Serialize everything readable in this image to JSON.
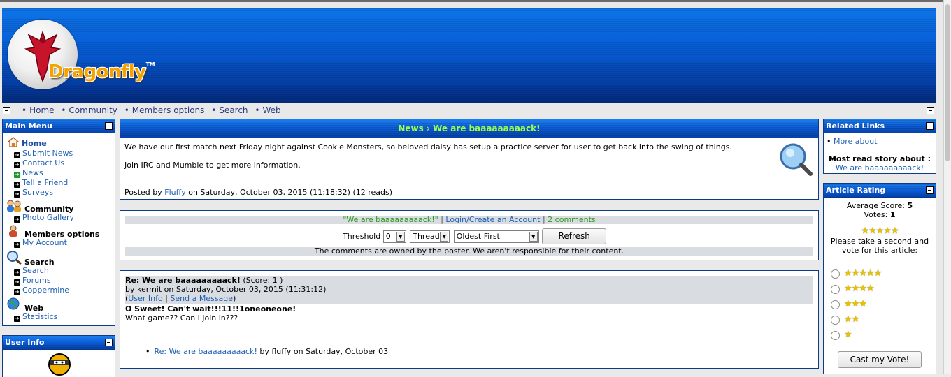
{
  "header": {
    "logo_text": "Dragonfly",
    "trademark": "TM"
  },
  "navbar": {
    "items": [
      {
        "label": "Home"
      },
      {
        "label": "Community"
      },
      {
        "label": "Members options"
      },
      {
        "label": "Search"
      },
      {
        "label": "Web"
      }
    ]
  },
  "main_menu": {
    "title": "Main Menu",
    "home": {
      "label": "Home",
      "links": [
        "Submit News",
        "Contact Us",
        "News",
        "Tell a Friend",
        "Surveys"
      ]
    },
    "community": {
      "label": "Community",
      "links": [
        "Photo Gallery"
      ]
    },
    "members": {
      "label": "Members options",
      "links": [
        "My Account"
      ]
    },
    "search": {
      "label": "Search",
      "links": [
        "Search",
        "Forums",
        "Coppermine"
      ]
    },
    "web": {
      "label": "Web",
      "links": [
        "Statistics"
      ]
    }
  },
  "user_info": {
    "title": "User Info"
  },
  "article": {
    "breadcrumb": "News › We are baaaaaaaaack!",
    "body_1": "We have our first match next Friday night against Cookie Monsters, so beloved daisy has setup a practice server for user to get back into the swing of things.",
    "body_2": "Join IRC and Mumble to get more information.",
    "posted_by_prefix": "Posted by",
    "author": "Fluffy",
    "posted_suffix": "on Saturday, October 03, 2015 (11:18:32) (12 reads)"
  },
  "comments_bar": {
    "title_link": "\"We are baaaaaaaaack!\"",
    "login_link": "Login/Create an Account",
    "count_link": "2 comments",
    "threshold_label": "Threshold",
    "threshold_value": "0",
    "mode_value": "Thread",
    "order_value": "Oldest First",
    "refresh_label": "Refresh",
    "disclaimer": "The comments are owned by the poster. We aren't responsible for their content."
  },
  "comment": {
    "title": "Re: We are baaaaaaaaack!",
    "score": "(Score: 1 )",
    "byline": "by kermit on Saturday, October 03, 2015 (11:31:12)",
    "user_info_link": "User Info",
    "send_message_link": "Send a Message",
    "headline": "O Sweet! Can't wait!!!11!!1oneoneone!",
    "text": "What game?? Can I join in???",
    "reply_link": "Re: We are baaaaaaaaack!",
    "reply_suffix": "by fluffy on Saturday, October 03"
  },
  "related_links": {
    "title": "Related Links",
    "more_about": "More about",
    "most_read_label": "Most read story about :",
    "most_read_link": "We are baaaaaaaaack!"
  },
  "article_rating": {
    "title": "Article Rating",
    "avg_label": "Average Score:",
    "avg_value": "5",
    "votes_label": "Votes:",
    "votes_value": "1",
    "average_stars": 5,
    "prompt": "Please take a second and vote for this article:",
    "options": [
      5,
      4,
      3,
      2,
      1
    ],
    "cast_label": "Cast my Vote!"
  },
  "colors": {
    "header_blue": "#075bd4",
    "link": "#1f5fb3",
    "breadcrumb_green": "#9cff4a",
    "comment_green": "#2a9a1a"
  }
}
